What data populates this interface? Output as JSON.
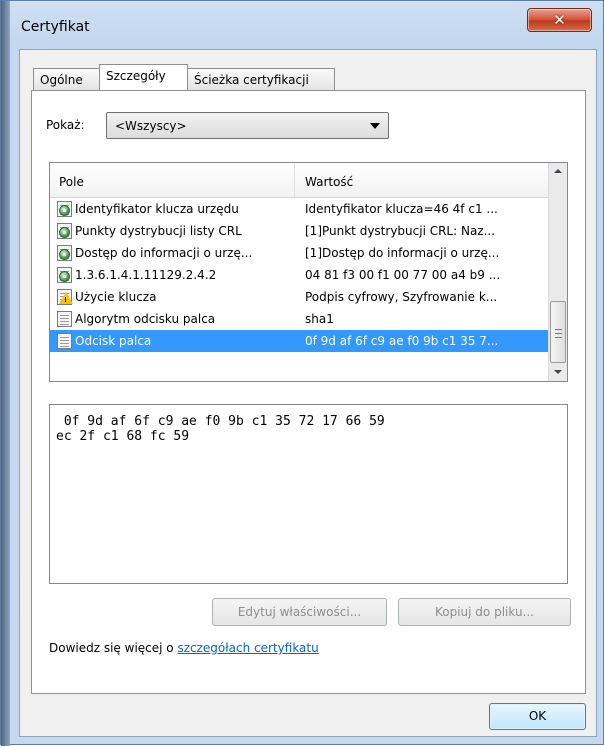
{
  "window": {
    "title": "Certyfikat",
    "close_glyph": "✕"
  },
  "tabs": [
    {
      "label": "Ogólne",
      "active": false
    },
    {
      "label": "Szczegóły",
      "active": true
    },
    {
      "label": "Ścieżka certyfikacji",
      "active": false
    }
  ],
  "show": {
    "label": "Pokaż:",
    "selected": "<Wszyscy>"
  },
  "list": {
    "columns": {
      "field": "Pole",
      "value": "Wartość"
    },
    "rows": [
      {
        "field": "Identyfikator klucza urzędu",
        "value": "Identyfikator klucza=46 4f c1 ...",
        "icon": "cert-extension-icon",
        "selected": false
      },
      {
        "field": "Punkty dystrybucji listy CRL",
        "value": "[1]Punkt dystrybucji CRL: Naz...",
        "icon": "cert-extension-icon",
        "selected": false
      },
      {
        "field": "Dostęp do informacji o urzę...",
        "value": "[1]Dostęp do informacji o urzę...",
        "icon": "cert-extension-icon",
        "selected": false
      },
      {
        "field": "1.3.6.1.4.1.11129.2.4.2",
        "value": "04 81 f3 00 f1 00 77 00 a4 b9 ...",
        "icon": "cert-extension-icon",
        "selected": false
      },
      {
        "field": "Użycie klucza",
        "value": "Podpis cyfrowy, Szyfrowanie k...",
        "icon": "critical-extension-warning-icon",
        "selected": false
      },
      {
        "field": "Algorytm odcisku palca",
        "value": "sha1",
        "icon": "cert-property-icon",
        "selected": false
      },
      {
        "field": "Odcisk palca",
        "value": "0f 9d af 6f c9 ae f0 9b c1 35 7...",
        "icon": "cert-property-icon",
        "selected": true
      }
    ]
  },
  "detail": {
    "text": " 0f 9d af 6f c9 ae f0 9b c1 35 72 17 66 59\nec 2f c1 68 fc 59"
  },
  "buttons": {
    "edit": "Edytuj właściwości...",
    "copy": "Kopiuj do pliku...",
    "ok": "OK"
  },
  "learn_more": {
    "prefix": "Dowiedz się więcej o",
    "link": "szczegółach certyfikatu"
  },
  "colors": {
    "selection": "#3399ff",
    "link": "#0066cc",
    "close_button": "#c13a1c"
  }
}
